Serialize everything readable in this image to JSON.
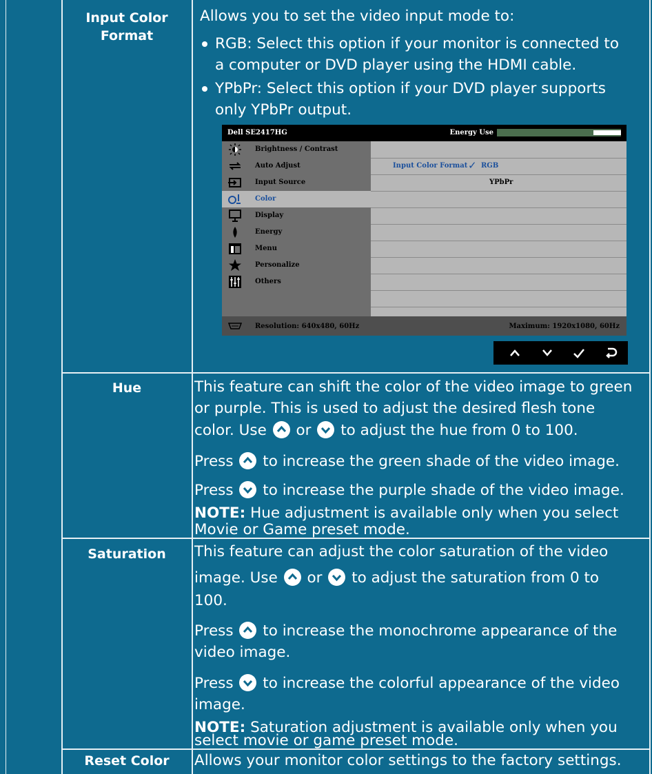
{
  "rows": {
    "input_color_format": {
      "label_line1": "Input Color",
      "label_line2": "Format",
      "intro": "Allows you to set the video input mode to:",
      "bullet1_line1": "RGB: Select this option if your monitor is connected to",
      "bullet1_line2": "a computer or DVD player using the HDMI cable.",
      "bullet2_line1": "YPbPr: Select this option if your DVD player supports",
      "bullet2_line2": "only YPbPr output."
    },
    "hue": {
      "label": "Hue",
      "p1_line1": "This feature can shift the color of the video image to green",
      "p1_line2": "or purple. This is used to adjust the desired flesh tone",
      "p1_line3a": "color. Use",
      "p1_line3b": "or",
      "p1_line3c": "to adjust the hue from 0 to 100.",
      "p2a": "Press",
      "p2b": "to increase the green shade of the video image.",
      "p3a": "Press",
      "p3b": "to increase the purple shade of the video image.",
      "note_bold": "NOTE:",
      "note_line1": " Hue adjustment is available only when you select",
      "note_line2": "Movie or Game preset mode."
    },
    "saturation": {
      "label": "Saturation",
      "p1_line1": "This feature can adjust the color saturation of the video",
      "p1_line2a": "image. Use",
      "p1_line2b": "or",
      "p1_line2c": "to adjust the saturation from 0 to",
      "p1_line3": "100.",
      "p2a": "Press",
      "p2b": "to increase the monochrome appearance of the",
      "p2_line2": "video image.",
      "p3a": "Press",
      "p3b": "to increase the colorful appearance of the video",
      "p3_line2": "image.",
      "note_bold": "NOTE:",
      "note_line1": " Saturation adjustment is available only when you",
      "note_line2": "select movie or game preset mode."
    },
    "reset_color": {
      "label": "Reset Color",
      "text": "Allows your monitor color settings to the factory settings."
    }
  },
  "osd": {
    "model": "Dell SE2417HG",
    "energy_label": "Energy Use",
    "energy_level": 0.22,
    "menu": [
      {
        "label": "Brightness / Contrast",
        "icon": "brightness-icon"
      },
      {
        "label": "Auto Adjust",
        "icon": "auto-adjust-icon"
      },
      {
        "label": "Input Source",
        "icon": "input-source-icon"
      },
      {
        "label": "Color",
        "icon": "color-icon"
      },
      {
        "label": "Display",
        "icon": "display-icon"
      },
      {
        "label": "Energy",
        "icon": "energy-icon"
      },
      {
        "label": "Menu",
        "icon": "menu-icon"
      },
      {
        "label": "Personalize",
        "icon": "star-icon"
      },
      {
        "label": "Others",
        "icon": "others-icon"
      }
    ],
    "selected_item": "Color",
    "submenu_title": "Input Color Format",
    "option_selected": "RGB",
    "option_other": "YPbPr",
    "resolution": "Resolution: 640x480, 60Hz",
    "maximum": "Maximum: 1920x1080, 60Hz",
    "nav_buttons": [
      "up-icon",
      "down-icon",
      "check-icon",
      "back-icon"
    ]
  },
  "colors": {
    "background": "#0e6a8f",
    "rule": "#e6f0f4",
    "osd_accent": "#1a4f9c"
  }
}
